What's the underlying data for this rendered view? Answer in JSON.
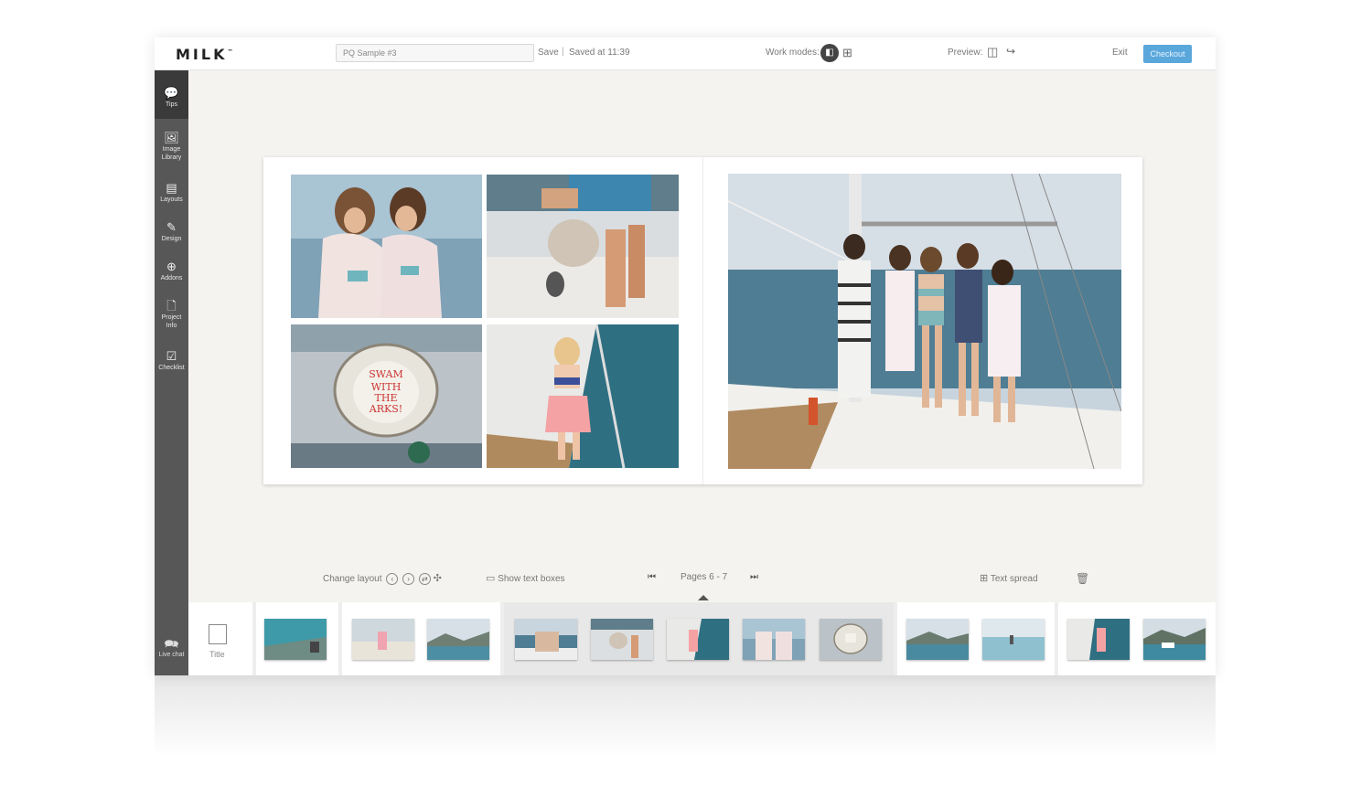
{
  "topbar": {
    "logo": "MILK",
    "logo_mark": "™",
    "project_name": "PQ Sample #3",
    "save_label": "Save",
    "separator": "|",
    "saved_at": "Saved at 11:39",
    "work_modes_label": "Work modes:",
    "preview_label": "Preview:",
    "exit_label": "Exit",
    "checkout_label": "Checkout",
    "accent_color": "#5aa7dc"
  },
  "sidebar": {
    "items": [
      {
        "label": "Tips",
        "icon": "tips-icon"
      },
      {
        "label": "Image Library",
        "icon": "image-library-icon"
      },
      {
        "label": "Layouts",
        "icon": "layouts-icon"
      },
      {
        "label": "Design",
        "icon": "design-icon"
      },
      {
        "label": "Addons",
        "icon": "addons-icon"
      },
      {
        "label": "Project Info",
        "icon": "project-info-icon"
      },
      {
        "label": "Checklist",
        "icon": "checklist-icon"
      }
    ],
    "live_chat": "Live chat"
  },
  "controls": {
    "change_layout": "Change layout",
    "show_text_boxes": "Show text boxes",
    "pages": "Pages 6 - 7",
    "text_spread": "Text spread"
  },
  "filmstrip": {
    "title_label": "Title"
  }
}
